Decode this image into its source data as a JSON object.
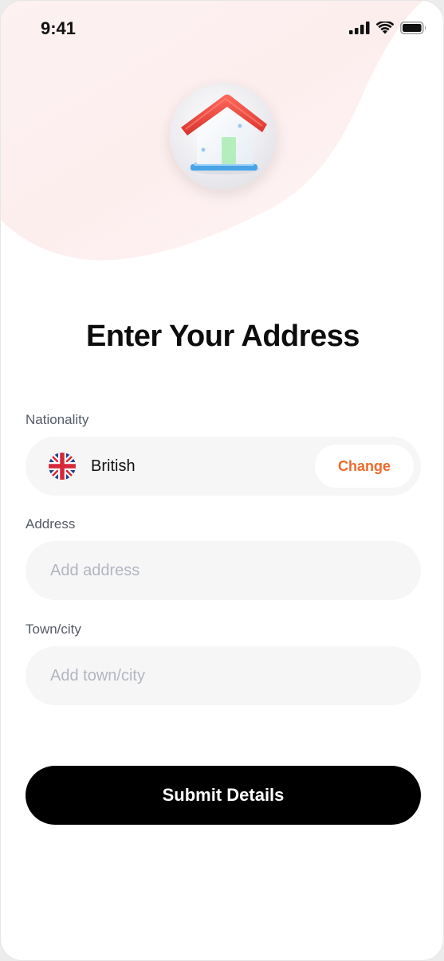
{
  "status_bar": {
    "time": "9:41",
    "icons": [
      "cellular-signal-icon",
      "wifi-icon",
      "battery-icon"
    ]
  },
  "hero": {
    "icon": "house-icon"
  },
  "page": {
    "title": "Enter Your Address"
  },
  "nationality": {
    "label": "Nationality",
    "flag_icon": "uk-flag-icon",
    "value": "British",
    "change_label": "Change"
  },
  "address": {
    "label": "Address",
    "placeholder": "Add address",
    "value": ""
  },
  "town": {
    "label": "Town/city",
    "placeholder": "Add town/city",
    "value": ""
  },
  "submit": {
    "label": "Submit Details"
  },
  "colors": {
    "accent_orange": "#ee6a2a",
    "button_black": "#000000",
    "field_bg": "#f6f6f7",
    "placeholder": "#b3b5c0",
    "blob_pink": "#fdeeee"
  }
}
